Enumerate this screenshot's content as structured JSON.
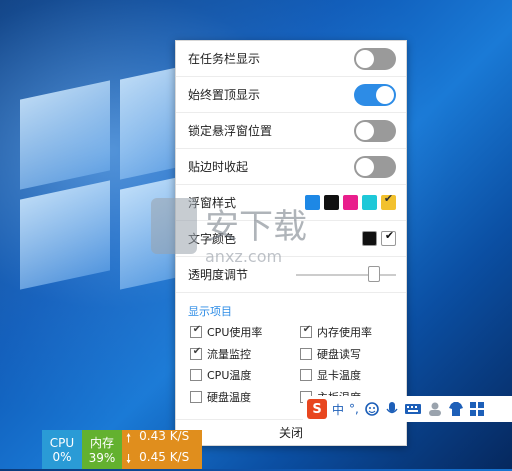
{
  "panel": {
    "rows": {
      "taskbar": {
        "label": "在任务栏显示",
        "on": false
      },
      "always_top": {
        "label": "始终置顶显示",
        "on": true
      },
      "lock_pos": {
        "label": "锁定悬浮窗位置",
        "on": false
      },
      "edge_hide": {
        "label": "贴边时收起",
        "on": false
      }
    },
    "style": {
      "label": "浮窗样式",
      "swatches": [
        "#1e88e5",
        "#111111",
        "#e91e8c",
        "#1ec8d8",
        "#f2c12e"
      ],
      "selected_index": 4
    },
    "text_color": {
      "label": "文字颜色",
      "swatches": [
        "#111111",
        "#ffffff"
      ],
      "selected_index": 1
    },
    "opacity": {
      "label": "透明度调节",
      "value_fraction": 0.78
    },
    "display_section": {
      "title": "显示项目",
      "items": [
        {
          "label": "CPU使用率",
          "checked": true
        },
        {
          "label": "内存使用率",
          "checked": true
        },
        {
          "label": "流量监控",
          "checked": true
        },
        {
          "label": "硬盘读写",
          "checked": false
        },
        {
          "label": "CPU温度",
          "checked": false
        },
        {
          "label": "显卡温度",
          "checked": false
        },
        {
          "label": "硬盘温度",
          "checked": false
        },
        {
          "label": "主板温度",
          "checked": false
        }
      ]
    },
    "close_label": "关闭"
  },
  "watermark": {
    "title": "安下载",
    "sub": "anxz.com"
  },
  "ime": {
    "s": "S",
    "lang": "中",
    "punct": "°,"
  },
  "monitor": {
    "cpu_label": "CPU",
    "cpu_value": "0%",
    "mem_label": "内存",
    "mem_value": "39%",
    "up": "0.43 K/S",
    "down": "0.45 K/S"
  }
}
